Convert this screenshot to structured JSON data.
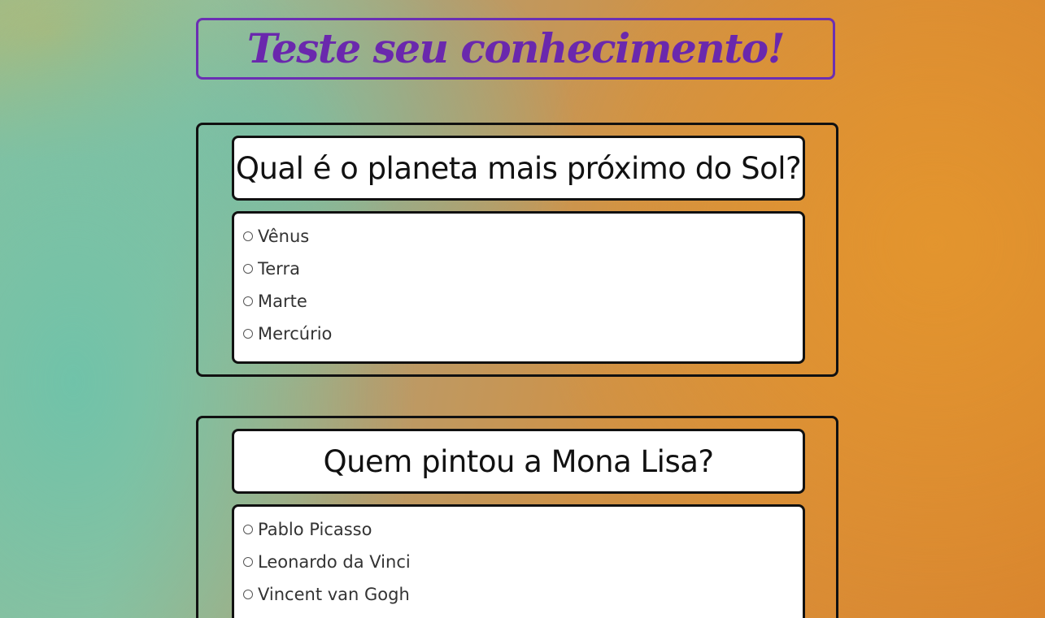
{
  "header": {
    "title": "Teste seu conhecimento!"
  },
  "questions": [
    {
      "question": "Qual é o planeta mais próximo do Sol?",
      "options": [
        "Vênus",
        "Terra",
        "Marte",
        "Mercúrio"
      ]
    },
    {
      "question": "Quem pintou a Mona Lisa?",
      "options": [
        "Pablo Picasso",
        "Leonardo da Vinci",
        "Vincent van Gogh"
      ]
    }
  ],
  "colors": {
    "title_accent": "#6a28ad",
    "card_border": "#111111",
    "card_background": "#ffffff"
  }
}
